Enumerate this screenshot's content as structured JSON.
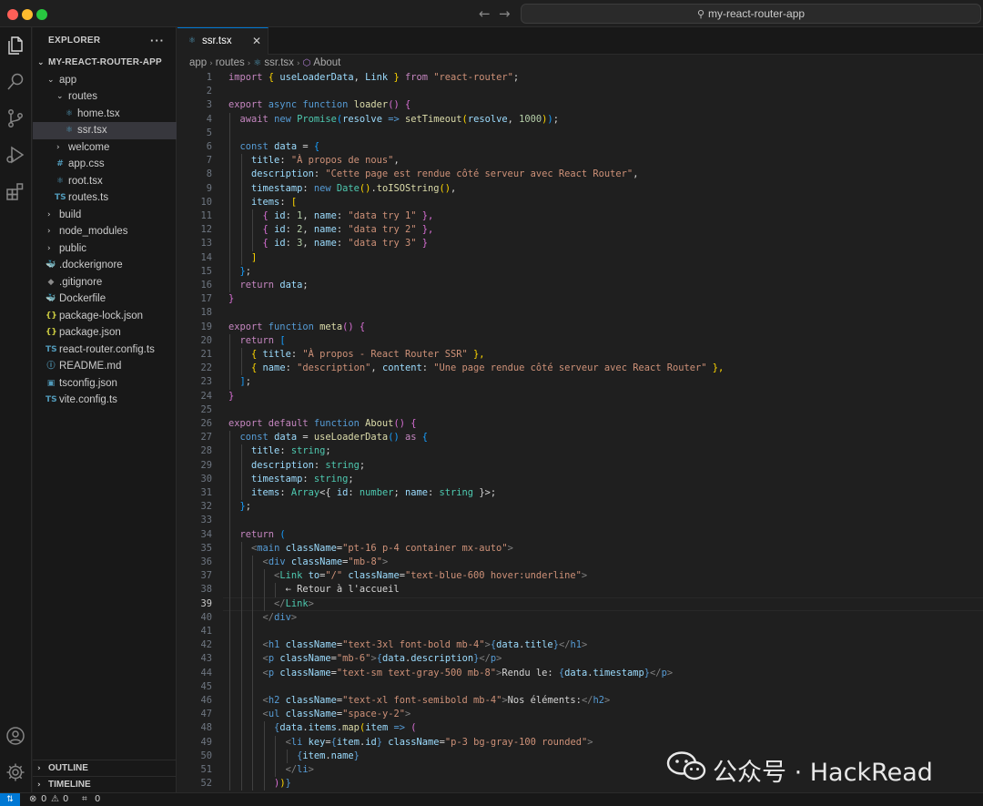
{
  "window": {
    "search_text": "my-react-router-app"
  },
  "explorer": {
    "header": "EXPLORER",
    "root": "MY-REACT-ROUTER-APP",
    "items": [
      {
        "label": "app",
        "kind": "folder",
        "open": true,
        "depth": 1
      },
      {
        "label": "routes",
        "kind": "folder",
        "open": true,
        "depth": 2
      },
      {
        "label": "home.tsx",
        "kind": "react",
        "depth": 3
      },
      {
        "label": "ssr.tsx",
        "kind": "react",
        "depth": 3,
        "selected": true
      },
      {
        "label": "welcome",
        "kind": "folder",
        "open": false,
        "depth": 2
      },
      {
        "label": "app.css",
        "kind": "css",
        "depth": 2
      },
      {
        "label": "root.tsx",
        "kind": "react",
        "depth": 2
      },
      {
        "label": "routes.ts",
        "kind": "ts",
        "depth": 2
      },
      {
        "label": "build",
        "kind": "folder",
        "open": false,
        "depth": 1
      },
      {
        "label": "node_modules",
        "kind": "folder",
        "open": false,
        "depth": 1
      },
      {
        "label": "public",
        "kind": "folder",
        "open": false,
        "depth": 1
      },
      {
        "label": ".dockerignore",
        "kind": "docker",
        "depth": 1
      },
      {
        "label": ".gitignore",
        "kind": "git",
        "depth": 1
      },
      {
        "label": "Dockerfile",
        "kind": "docker",
        "depth": 1
      },
      {
        "label": "package-lock.json",
        "kind": "json",
        "depth": 1
      },
      {
        "label": "package.json",
        "kind": "json",
        "depth": 1
      },
      {
        "label": "react-router.config.ts",
        "kind": "ts",
        "depth": 1
      },
      {
        "label": "README.md",
        "kind": "info",
        "depth": 1
      },
      {
        "label": "tsconfig.json",
        "kind": "tsconfig",
        "depth": 1
      },
      {
        "label": "vite.config.ts",
        "kind": "ts",
        "depth": 1
      }
    ],
    "outline_label": "OUTLINE",
    "timeline_label": "TIMELINE"
  },
  "editor": {
    "tab_label": "ssr.tsx",
    "breadcrumb": [
      "app",
      "routes",
      "ssr.tsx",
      "About"
    ],
    "current_line": 39,
    "lines": [
      [
        [
          "import ",
          "k"
        ],
        [
          "{ ",
          "y"
        ],
        [
          "useLoaderData",
          "v"
        ],
        [
          ", ",
          "p"
        ],
        [
          "Link ",
          "v"
        ],
        [
          "}",
          "y"
        ],
        [
          " from ",
          "k"
        ],
        [
          "\"react-router\"",
          "s"
        ],
        [
          ";",
          "p"
        ]
      ],
      [],
      [
        [
          "export ",
          "k"
        ],
        [
          "async ",
          "b"
        ],
        [
          "function ",
          "b"
        ],
        [
          "loader",
          "f"
        ],
        [
          "() ",
          "m"
        ],
        [
          "{",
          "m"
        ]
      ],
      [
        [
          "  "
        ],
        [
          "await ",
          "k"
        ],
        [
          "new ",
          "b"
        ],
        [
          "Promise",
          "t"
        ],
        [
          "(",
          "c"
        ],
        [
          "resolve ",
          "v"
        ],
        [
          "=> ",
          "b"
        ],
        [
          "setTimeout",
          "f"
        ],
        [
          "(",
          "y"
        ],
        [
          "resolve",
          "v"
        ],
        [
          ", ",
          "p"
        ],
        [
          "1000",
          "n"
        ],
        [
          ")",
          "y"
        ],
        [
          ")",
          "c"
        ],
        [
          ";",
          "p"
        ]
      ],
      [],
      [
        [
          "  "
        ],
        [
          "const ",
          "b"
        ],
        [
          "data ",
          "v"
        ],
        [
          "= ",
          "p"
        ],
        [
          "{",
          "c"
        ]
      ],
      [
        [
          "    "
        ],
        [
          "title",
          "v"
        ],
        [
          ": ",
          "p"
        ],
        [
          "\"À propos de nous\"",
          "s"
        ],
        [
          ",",
          "p"
        ]
      ],
      [
        [
          "    "
        ],
        [
          "description",
          "v"
        ],
        [
          ": ",
          "p"
        ],
        [
          "\"Cette page est rendue côté serveur avec React Router\"",
          "s"
        ],
        [
          ",",
          "p"
        ]
      ],
      [
        [
          "    "
        ],
        [
          "timestamp",
          "v"
        ],
        [
          ": ",
          "p"
        ],
        [
          "new ",
          "b"
        ],
        [
          "Date",
          "t"
        ],
        [
          "()",
          "y"
        ],
        [
          ".",
          "p"
        ],
        [
          "toISOString",
          "f"
        ],
        [
          "()",
          "y"
        ],
        [
          ",",
          "p"
        ]
      ],
      [
        [
          "    "
        ],
        [
          "items",
          "v"
        ],
        [
          ": ",
          "p"
        ],
        [
          "[",
          "y"
        ]
      ],
      [
        [
          "      "
        ],
        [
          "{ ",
          "m"
        ],
        [
          "id",
          "v"
        ],
        [
          ": ",
          "p"
        ],
        [
          "1",
          "n"
        ],
        [
          ", ",
          "p"
        ],
        [
          "name",
          "v"
        ],
        [
          ": ",
          "p"
        ],
        [
          "\"data try 1\"",
          "s"
        ],
        [
          " },",
          "m"
        ]
      ],
      [
        [
          "      "
        ],
        [
          "{ ",
          "m"
        ],
        [
          "id",
          "v"
        ],
        [
          ": ",
          "p"
        ],
        [
          "2",
          "n"
        ],
        [
          ", ",
          "p"
        ],
        [
          "name",
          "v"
        ],
        [
          ": ",
          "p"
        ],
        [
          "\"data try 2\"",
          "s"
        ],
        [
          " },",
          "m"
        ]
      ],
      [
        [
          "      "
        ],
        [
          "{ ",
          "m"
        ],
        [
          "id",
          "v"
        ],
        [
          ": ",
          "p"
        ],
        [
          "3",
          "n"
        ],
        [
          ", ",
          "p"
        ],
        [
          "name",
          "v"
        ],
        [
          ": ",
          "p"
        ],
        [
          "\"data try 3\"",
          "s"
        ],
        [
          " }",
          "m"
        ]
      ],
      [
        [
          "    "
        ],
        [
          "]",
          "y"
        ]
      ],
      [
        [
          "  "
        ],
        [
          "}",
          "c"
        ],
        [
          ";",
          "p"
        ]
      ],
      [
        [
          "  "
        ],
        [
          "return ",
          "k"
        ],
        [
          "data",
          "v"
        ],
        [
          ";",
          "p"
        ]
      ],
      [
        [
          "}",
          "m"
        ]
      ],
      [],
      [
        [
          "export ",
          "k"
        ],
        [
          "function ",
          "b"
        ],
        [
          "meta",
          "f"
        ],
        [
          "() ",
          "m"
        ],
        [
          "{",
          "m"
        ]
      ],
      [
        [
          "  "
        ],
        [
          "return ",
          "k"
        ],
        [
          "[",
          "c"
        ]
      ],
      [
        [
          "    "
        ],
        [
          "{ ",
          "y"
        ],
        [
          "title",
          "v"
        ],
        [
          ": ",
          "p"
        ],
        [
          "\"À propos - React Router SSR\"",
          "s"
        ],
        [
          " },",
          "y"
        ]
      ],
      [
        [
          "    "
        ],
        [
          "{ ",
          "y"
        ],
        [
          "name",
          "v"
        ],
        [
          ": ",
          "p"
        ],
        [
          "\"description\"",
          "s"
        ],
        [
          ", ",
          "p"
        ],
        [
          "content",
          "v"
        ],
        [
          ": ",
          "p"
        ],
        [
          "\"Une page rendue côté serveur avec React Router\"",
          "s"
        ],
        [
          " },",
          "y"
        ]
      ],
      [
        [
          "  "
        ],
        [
          "]",
          "c"
        ],
        [
          ";",
          "p"
        ]
      ],
      [
        [
          "}",
          "m"
        ]
      ],
      [],
      [
        [
          "export ",
          "k"
        ],
        [
          "default ",
          "k"
        ],
        [
          "function ",
          "b"
        ],
        [
          "About",
          "f"
        ],
        [
          "() ",
          "m"
        ],
        [
          "{",
          "m"
        ]
      ],
      [
        [
          "  "
        ],
        [
          "const ",
          "b"
        ],
        [
          "data ",
          "v"
        ],
        [
          "= ",
          "p"
        ],
        [
          "useLoaderData",
          "f"
        ],
        [
          "() ",
          "c"
        ],
        [
          "as ",
          "k"
        ],
        [
          "{",
          "c"
        ]
      ],
      [
        [
          "    "
        ],
        [
          "title",
          "v"
        ],
        [
          ": ",
          "p"
        ],
        [
          "string",
          "t"
        ],
        [
          ";",
          "p"
        ]
      ],
      [
        [
          "    "
        ],
        [
          "description",
          "v"
        ],
        [
          ": ",
          "p"
        ],
        [
          "string",
          "t"
        ],
        [
          ";",
          "p"
        ]
      ],
      [
        [
          "    "
        ],
        [
          "timestamp",
          "v"
        ],
        [
          ": ",
          "p"
        ],
        [
          "string",
          "t"
        ],
        [
          ";",
          "p"
        ]
      ],
      [
        [
          "    "
        ],
        [
          "items",
          "v"
        ],
        [
          ": ",
          "p"
        ],
        [
          "Array",
          "t"
        ],
        [
          "<{ ",
          "p"
        ],
        [
          "id",
          "v"
        ],
        [
          ": ",
          "p"
        ],
        [
          "number",
          "t"
        ],
        [
          "; ",
          "p"
        ],
        [
          "name",
          "v"
        ],
        [
          ": ",
          "p"
        ],
        [
          "string",
          "t"
        ],
        [
          " }>",
          "p"
        ],
        [
          ";",
          "p"
        ]
      ],
      [
        [
          "  "
        ],
        [
          "}",
          "c"
        ],
        [
          ";",
          "p"
        ]
      ],
      [],
      [
        [
          "  "
        ],
        [
          "return ",
          "k"
        ],
        [
          "(",
          "c"
        ]
      ],
      [
        [
          "    "
        ],
        [
          "<",
          "g"
        ],
        [
          "main ",
          "b"
        ],
        [
          "className",
          "v"
        ],
        [
          "=",
          "p"
        ],
        [
          "\"pt-16 p-4 container mx-auto\"",
          "s"
        ],
        [
          ">",
          "g"
        ]
      ],
      [
        [
          "      "
        ],
        [
          "<",
          "g"
        ],
        [
          "div ",
          "b"
        ],
        [
          "className",
          "v"
        ],
        [
          "=",
          "p"
        ],
        [
          "\"mb-8\"",
          "s"
        ],
        [
          ">",
          "g"
        ]
      ],
      [
        [
          "        "
        ],
        [
          "<",
          "g"
        ],
        [
          "Link ",
          "t"
        ],
        [
          "to",
          "v"
        ],
        [
          "=",
          "p"
        ],
        [
          "\"/\" ",
          "s"
        ],
        [
          "className",
          "v"
        ],
        [
          "=",
          "p"
        ],
        [
          "\"text-blue-600 hover:underline\"",
          "s"
        ],
        [
          ">",
          "g"
        ]
      ],
      [
        [
          "          "
        ],
        [
          "← Retour à l'accueil",
          "p"
        ]
      ],
      [
        [
          "        "
        ],
        [
          "</",
          "g"
        ],
        [
          "Link",
          "t"
        ],
        [
          ">",
          "g"
        ]
      ],
      [
        [
          "      "
        ],
        [
          "</",
          "g"
        ],
        [
          "div",
          "b"
        ],
        [
          ">",
          "g"
        ]
      ],
      [],
      [
        [
          "      "
        ],
        [
          "<",
          "g"
        ],
        [
          "h1 ",
          "b"
        ],
        [
          "className",
          "v"
        ],
        [
          "=",
          "p"
        ],
        [
          "\"text-3xl font-bold mb-4\"",
          "s"
        ],
        [
          ">",
          "g"
        ],
        [
          "{",
          "b"
        ],
        [
          "data",
          "v"
        ],
        [
          ".",
          "p"
        ],
        [
          "title",
          "v"
        ],
        [
          "}",
          "b"
        ],
        [
          "</",
          "g"
        ],
        [
          "h1",
          "b"
        ],
        [
          ">",
          "g"
        ]
      ],
      [
        [
          "      "
        ],
        [
          "<",
          "g"
        ],
        [
          "p ",
          "b"
        ],
        [
          "className",
          "v"
        ],
        [
          "=",
          "p"
        ],
        [
          "\"mb-6\"",
          "s"
        ],
        [
          ">",
          "g"
        ],
        [
          "{",
          "b"
        ],
        [
          "data",
          "v"
        ],
        [
          ".",
          "p"
        ],
        [
          "description",
          "v"
        ],
        [
          "}",
          "b"
        ],
        [
          "</",
          "g"
        ],
        [
          "p",
          "b"
        ],
        [
          ">",
          "g"
        ]
      ],
      [
        [
          "      "
        ],
        [
          "<",
          "g"
        ],
        [
          "p ",
          "b"
        ],
        [
          "className",
          "v"
        ],
        [
          "=",
          "p"
        ],
        [
          "\"text-sm text-gray-500 mb-8\"",
          "s"
        ],
        [
          ">",
          "g"
        ],
        [
          "Rendu le: ",
          "p"
        ],
        [
          "{",
          "b"
        ],
        [
          "data",
          "v"
        ],
        [
          ".",
          "p"
        ],
        [
          "timestamp",
          "v"
        ],
        [
          "}",
          "b"
        ],
        [
          "</",
          "g"
        ],
        [
          "p",
          "b"
        ],
        [
          ">",
          "g"
        ]
      ],
      [],
      [
        [
          "      "
        ],
        [
          "<",
          "g"
        ],
        [
          "h2 ",
          "b"
        ],
        [
          "className",
          "v"
        ],
        [
          "=",
          "p"
        ],
        [
          "\"text-xl font-semibold mb-4\"",
          "s"
        ],
        [
          ">",
          "g"
        ],
        [
          "Nos éléments:",
          "p"
        ],
        [
          "</",
          "g"
        ],
        [
          "h2",
          "b"
        ],
        [
          ">",
          "g"
        ]
      ],
      [
        [
          "      "
        ],
        [
          "<",
          "g"
        ],
        [
          "ul ",
          "b"
        ],
        [
          "className",
          "v"
        ],
        [
          "=",
          "p"
        ],
        [
          "\"space-y-2\"",
          "s"
        ],
        [
          ">",
          "g"
        ]
      ],
      [
        [
          "        "
        ],
        [
          "{",
          "b"
        ],
        [
          "data",
          "v"
        ],
        [
          ".",
          "p"
        ],
        [
          "items",
          "v"
        ],
        [
          ".",
          "p"
        ],
        [
          "map",
          "f"
        ],
        [
          "(",
          "y"
        ],
        [
          "item ",
          "v"
        ],
        [
          "=> ",
          "b"
        ],
        [
          "(",
          "m"
        ]
      ],
      [
        [
          "          "
        ],
        [
          "<",
          "g"
        ],
        [
          "li ",
          "b"
        ],
        [
          "key",
          "v"
        ],
        [
          "=",
          "p"
        ],
        [
          "{",
          "b"
        ],
        [
          "item",
          "v"
        ],
        [
          ".",
          "p"
        ],
        [
          "id",
          "v"
        ],
        [
          "} ",
          "b"
        ],
        [
          "className",
          "v"
        ],
        [
          "=",
          "p"
        ],
        [
          "\"p-3 bg-gray-100 rounded\"",
          "s"
        ],
        [
          ">",
          "g"
        ]
      ],
      [
        [
          "            "
        ],
        [
          "{",
          "b"
        ],
        [
          "item",
          "v"
        ],
        [
          ".",
          "p"
        ],
        [
          "name",
          "v"
        ],
        [
          "}",
          "b"
        ]
      ],
      [
        [
          "          "
        ],
        [
          "</",
          "g"
        ],
        [
          "li",
          "b"
        ],
        [
          ">",
          "g"
        ]
      ],
      [
        [
          "        "
        ],
        [
          ")",
          "m"
        ],
        [
          ")",
          "y"
        ],
        [
          "}",
          "b"
        ]
      ]
    ]
  },
  "status": {
    "errors": "0",
    "warnings": "0",
    "ports": "0"
  },
  "watermark": {
    "text": "公众号 · HackRead"
  },
  "colors": {
    "accent": "#0078d4",
    "background": "#1f1f1f",
    "sidebar": "#181818"
  }
}
